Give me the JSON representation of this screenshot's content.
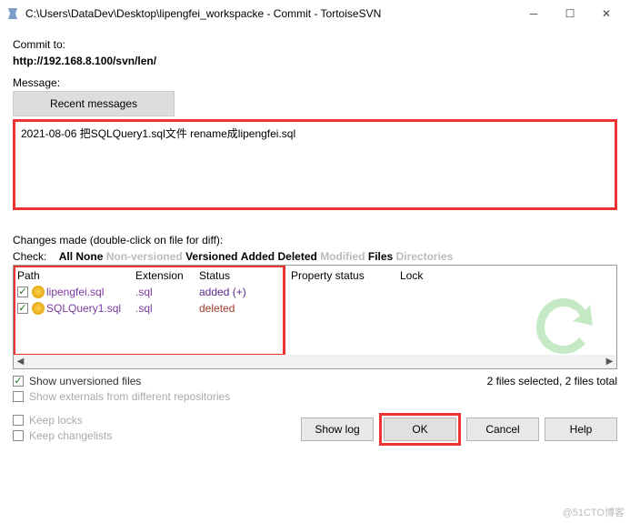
{
  "titlebar": {
    "title": "C:\\Users\\DataDev\\Desktop\\lipengfei_workspacke - Commit - TortoiseSVN"
  },
  "commit_to_label": "Commit to:",
  "commit_url": "http://192.168.8.100/svn/len/",
  "message_label": "Message:",
  "recent_button": "Recent messages",
  "commit_message": "2021-08-06 把SQLQuery1.sql文件 rename成lipengfei.sql",
  "changes_label": "Changes made (double-click on file for diff):",
  "filters": {
    "check": "Check:",
    "all": "All",
    "none": "None",
    "nonversioned": "Non-versioned",
    "versioned": "Versioned",
    "added": "Added",
    "deleted": "Deleted",
    "modified": "Modified",
    "files": "Files",
    "directories": "Directories"
  },
  "headers": {
    "path": "Path",
    "ext": "Extension",
    "status": "Status",
    "prop": "Property status",
    "lock": "Lock"
  },
  "files": [
    {
      "name": "lipengfei.sql",
      "ext": ".sql",
      "status": "added (+)",
      "status_class": "added",
      "checked": true
    },
    {
      "name": "SQLQuery1.sql",
      "ext": ".sql",
      "status": "deleted",
      "status_class": "deleted",
      "checked": true
    }
  ],
  "options": {
    "show_unversioned": "Show unversioned files",
    "show_externals": "Show externals from different repositories",
    "keep_locks": "Keep locks",
    "keep_changelists": "Keep changelists"
  },
  "stats": "2 files selected, 2 files total",
  "buttons": {
    "showlog": "Show log",
    "ok": "OK",
    "cancel": "Cancel",
    "help": "Help"
  },
  "watermark": "@51CTO博客"
}
